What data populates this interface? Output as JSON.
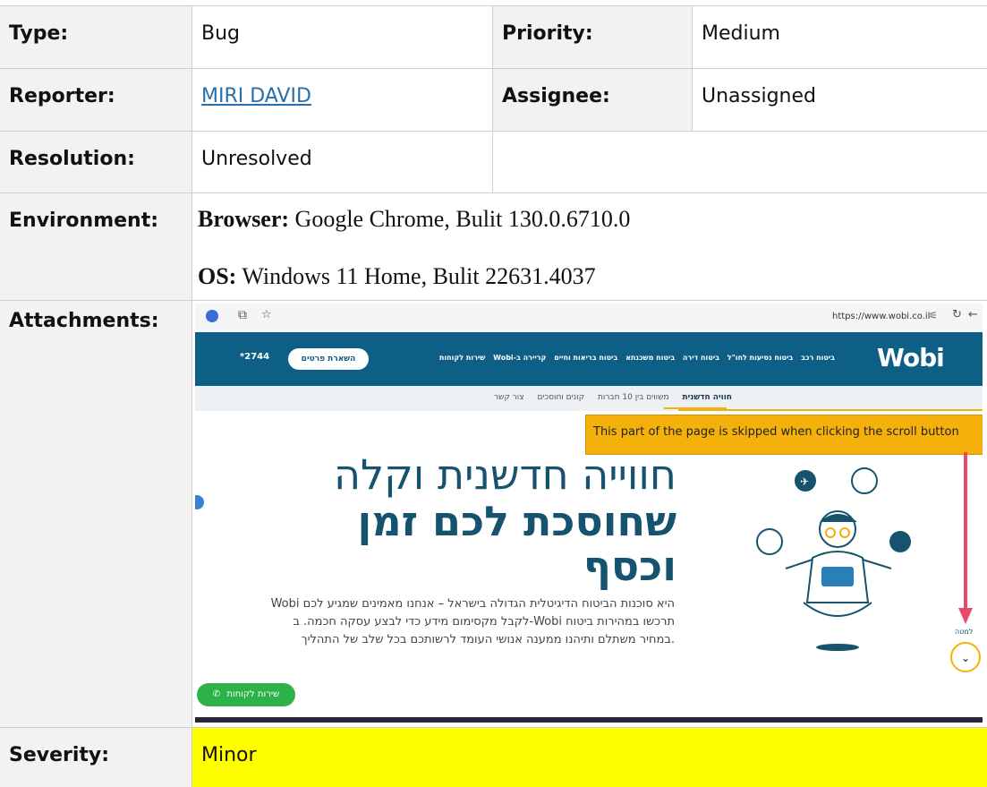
{
  "fields": {
    "type_label": "Type:",
    "type_value": "Bug",
    "priority_label": "Priority:",
    "priority_value": "Medium",
    "reporter_label": "Reporter:",
    "reporter_value": "MIRI DAVID",
    "assignee_label": "Assignee:",
    "assignee_value": "Unassigned",
    "resolution_label": "Resolution:",
    "resolution_value": "Unresolved",
    "environment_label": "Environment:",
    "env_browser_label": "Browser:",
    "env_browser_value": " Google Chrome, Bulit 130.0.6710.0",
    "env_os_label": "OS:",
    "env_os_value": " Windows 11 Home, Bulit 22631.4037",
    "attachments_label": "Attachments:",
    "severity_label": "Severity:",
    "severity_value": "Minor"
  },
  "attachment": {
    "url": "https://www.wobi.co.il",
    "logo": "Wobi",
    "phone": "*2744",
    "cta_button": "השארת פרטים",
    "nav_items": [
      "שירות לקוחות",
      "קריירה ב-Wobi",
      "ביטוח בריאות וחיים",
      "ביטוח משכנתא",
      "ביטוח דירה",
      "ביטוח נסיעות לחו\"ל",
      "ביטוח רכב"
    ],
    "subnav_items": [
      "חוויה חדשנית",
      "משווים בין 10 חברות",
      "קונים וחוסכים",
      "צור קשר"
    ],
    "headline_1": "חווייה חדשנית וקלה",
    "headline_2": "שחוסכת לכם זמן",
    "headline_3": "וכסף",
    "body_text": "Wobi היא סוכנות הביטוח הדיגיטלית הגדולה בישראל – אנחנו מאמינים שמגיע לכם לקבל מקסימום מידע כדי לבצע עסקה חכמה. ב-Wobi תרכשו במהירות ביטוח במחיר משתלם ותיהנו ממענה אנושי העומד לרשותכם בכל שלב של התהליך.",
    "whatsapp_button": "שירות לקוחות",
    "scroll_label": "למטה",
    "annotation": "This part of the page is skipped when clicking the scroll button",
    "colors": {
      "navbar": "#0e5f86",
      "annotation": "#f5b10b",
      "arrow": "#e8496b",
      "whatsapp": "#2bb34a",
      "severity": "#ffff00"
    }
  }
}
